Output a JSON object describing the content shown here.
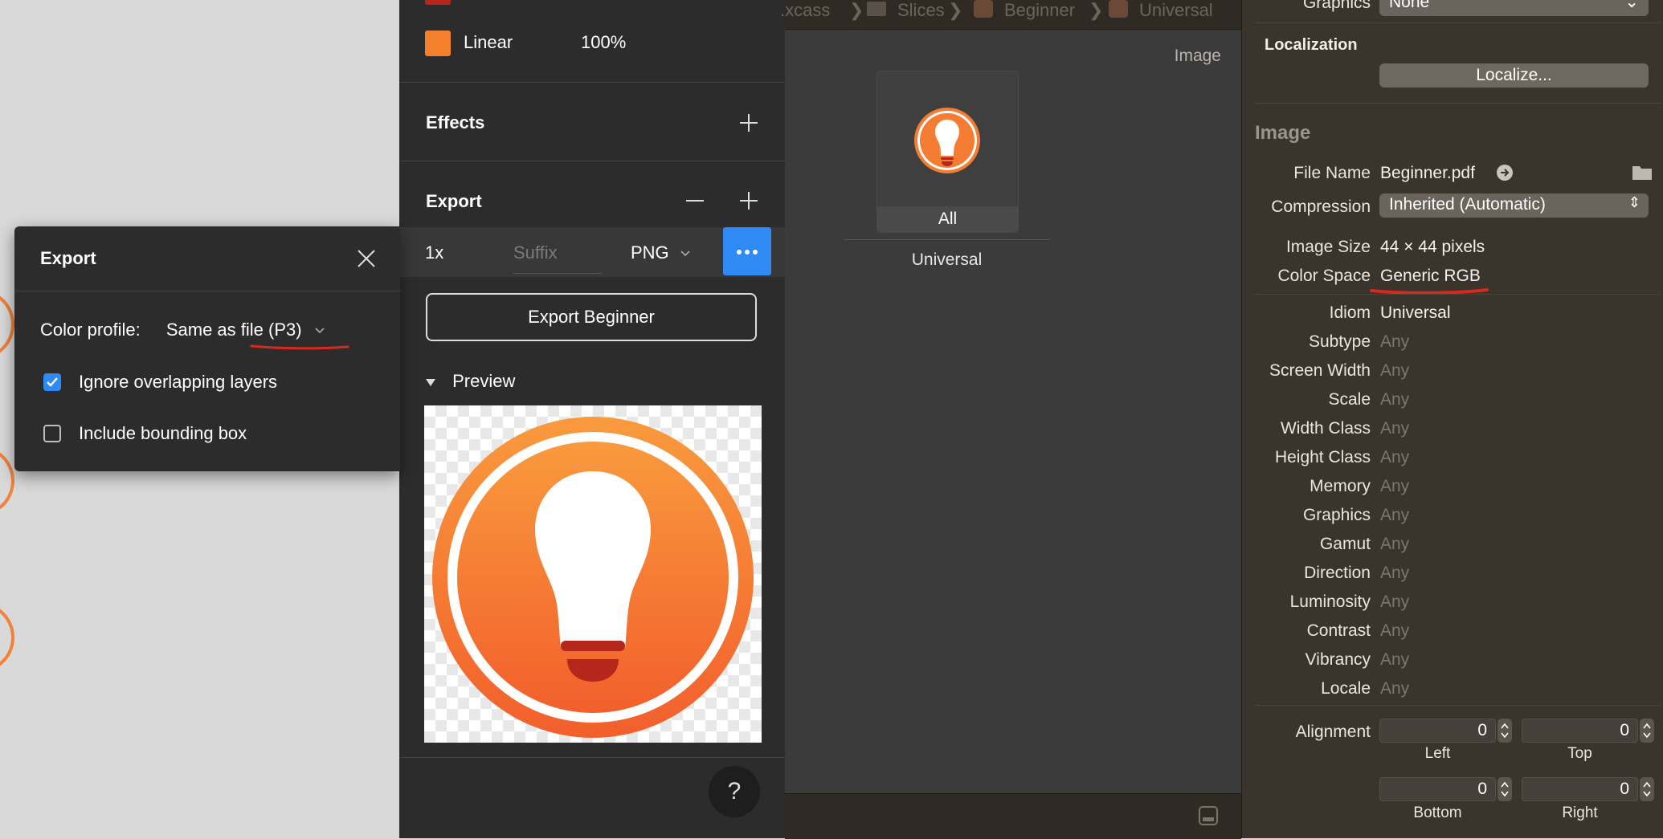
{
  "popup": {
    "title": "Export",
    "color_profile_label": "Color profile:",
    "color_profile_value": "Same as file (P3)",
    "ignore_overlapping_label": "Ignore overlapping layers",
    "ignore_overlapping_checked": true,
    "include_bbox_label": "Include bounding box",
    "include_bbox_checked": false
  },
  "figma": {
    "fill_mode": "Linear",
    "fill_opacity": "100%",
    "fill_color": "#f5812f",
    "effects_title": "Effects",
    "export_title": "Export",
    "export_scale": "1x",
    "export_suffix_placeholder": "Suffix",
    "export_format": "PNG",
    "export_button": "Export Beginner",
    "preview_label": "Preview",
    "help_label": "?"
  },
  "xcode": {
    "breadcrumbs": [
      ".xcass",
      "Slices",
      "Beginner",
      "Universal"
    ],
    "image_label": "Image",
    "slot_label": "All",
    "slot_group": "Universal"
  },
  "inspector": {
    "top_graphics_label": "Graphics",
    "top_graphics_value": "None",
    "localization_title": "Localization",
    "localize_button": "Localize...",
    "image_title": "Image",
    "rows": {
      "file_name_label": "File Name",
      "file_name_value": "Beginner.pdf",
      "compression_label": "Compression",
      "compression_value": "Inherited (Automatic)",
      "image_size_label": "Image Size",
      "image_size_value": "44 × 44 pixels",
      "color_space_label": "Color Space",
      "color_space_value": "Generic RGB",
      "idiom_label": "Idiom",
      "idiom_value": "Universal"
    },
    "traits": [
      {
        "label": "Subtype",
        "value": "Any"
      },
      {
        "label": "Screen Width",
        "value": "Any"
      },
      {
        "label": "Scale",
        "value": "Any"
      },
      {
        "label": "Width Class",
        "value": "Any"
      },
      {
        "label": "Height Class",
        "value": "Any"
      },
      {
        "label": "Memory",
        "value": "Any"
      },
      {
        "label": "Graphics",
        "value": "Any"
      },
      {
        "label": "Gamut",
        "value": "Any"
      },
      {
        "label": "Direction",
        "value": "Any"
      },
      {
        "label": "Luminosity",
        "value": "Any"
      },
      {
        "label": "Contrast",
        "value": "Any"
      },
      {
        "label": "Vibrancy",
        "value": "Any"
      },
      {
        "label": "Locale",
        "value": "Any"
      }
    ],
    "alignment_label": "Alignment",
    "alignment": {
      "left": {
        "value": "0",
        "caption": "Left"
      },
      "top": {
        "value": "0",
        "caption": "Top"
      },
      "bottom": {
        "value": "0",
        "caption": "Bottom"
      },
      "right": {
        "value": "0",
        "caption": "Right"
      }
    }
  },
  "colors": {
    "accent_orange": "#f5812f",
    "annotation_red": "#d9291c",
    "checkbox_blue": "#2f8af5"
  }
}
